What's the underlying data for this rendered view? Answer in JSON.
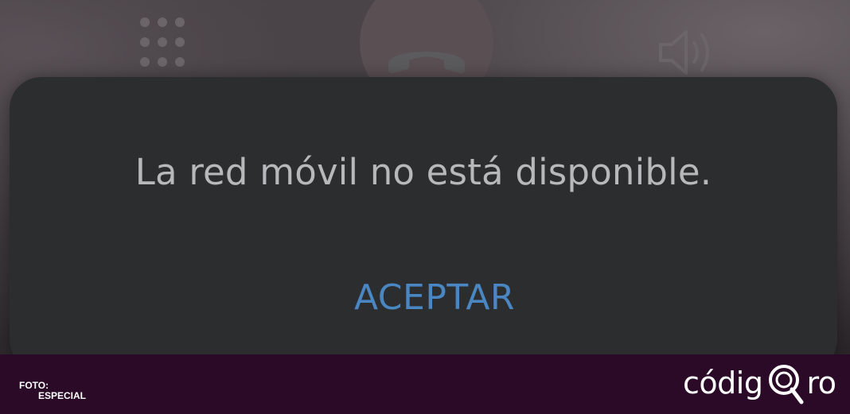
{
  "call_screen": {
    "icons": [
      "keypad-icon",
      "end-call-icon",
      "speaker-icon"
    ]
  },
  "dialog": {
    "message": "La red móvil no está disponible.",
    "button_label": "ACEPTAR",
    "button_color": "#4a86c2"
  },
  "footer": {
    "credit_label": "FOTO:",
    "credit_value": "ESPECIAL",
    "brand_start": "códig",
    "brand_end": "ro",
    "background": "#2a0a27"
  }
}
